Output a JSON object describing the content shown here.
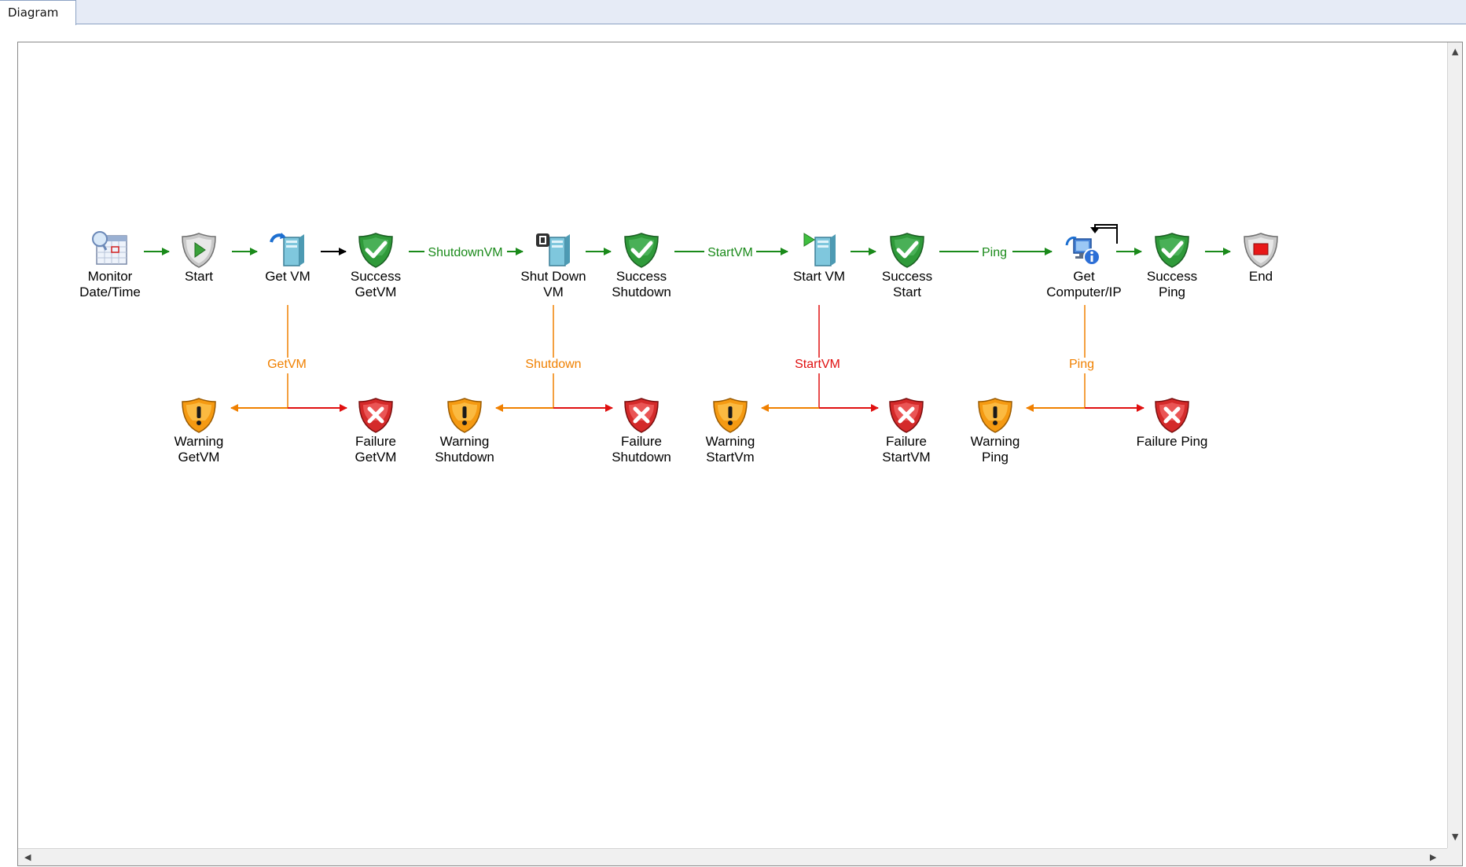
{
  "tab": {
    "label": "Diagram"
  },
  "nodes": {
    "monitor": "Monitor\nDate/Time",
    "start": "Start",
    "getvm": "Get VM",
    "success_getvm": "Success\nGetVM",
    "shutdown_vm": "Shut Down\nVM",
    "success_shutdown": "Success\nShutdown",
    "start_vm": "Start VM",
    "success_start": "Success\nStart",
    "get_computer_ip": "Get\nComputer/IP",
    "success_ping": "Success\nPing",
    "end": "End",
    "warning_getvm": "Warning\nGetVM",
    "failure_getvm": "Failure\nGetVM",
    "warning_shutdown": "Warning\nShutdown",
    "failure_shutdown": "Failure\nShutdown",
    "warning_startvm": "Warning\nStartVm",
    "failure_startvm": "Failure\nStartVM",
    "warning_ping": "Warning\nPing",
    "failure_ping": "Failure Ping"
  },
  "links": {
    "shutdownvm": "ShutdownVM",
    "startvm": "StartVM",
    "ping": "Ping",
    "branch_getvm": "GetVM",
    "branch_shutdown": "Shutdown",
    "branch_startvm": "StartVM",
    "branch_ping": "Ping"
  },
  "scroll": {
    "up": "▲",
    "down": "▼",
    "left": "◀",
    "right": "▶"
  },
  "colors": {
    "success_link": "#1a8a1a",
    "warning_link": "#f08000",
    "failure_link": "#e01010",
    "default_link": "#000000"
  },
  "icons": {
    "monitor": "calendar-monitor-icon",
    "start": "play-shield-icon",
    "getvm": "server-refresh-icon",
    "success": "green-check-shield-icon",
    "shutdown": "server-shutdown-icon",
    "startvm": "server-start-icon",
    "getip": "computer-info-icon",
    "end": "stop-shield-icon",
    "warning": "warning-shield-icon",
    "failure": "failure-shield-icon"
  }
}
